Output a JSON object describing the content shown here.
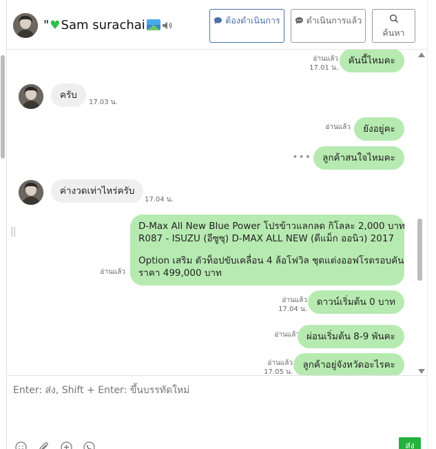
{
  "header": {
    "contact_prefix": "\"",
    "contact_name": "Sam surachai",
    "buttons": {
      "to_do": "ต้องดำเนินการ",
      "done": "ดำเนินการแล้ว",
      "search": "ค้นหา"
    }
  },
  "messages": [
    {
      "dir": "out",
      "text": "คันนี้ไหมคะ",
      "read": "อ่านแล้ว",
      "time": "17.01 น."
    },
    {
      "dir": "in",
      "text": "ครับ",
      "time": "17.03 น."
    },
    {
      "dir": "out",
      "text": "ยังอยู่คะ",
      "read": "อ่านแล้ว",
      "time": ""
    },
    {
      "dir": "out",
      "text": "ลูกค้าสนใจไหมคะ",
      "read": "",
      "time": ""
    },
    {
      "dir": "in",
      "text": "ค่างวดเท่าไหร่ครับ",
      "time": "17.04 น."
    },
    {
      "dir": "out",
      "line1": "D-Max All New Blue Power โปรข้าวแลกลด กิโลละ 2,000 บาท",
      "line2": "R087 - ISUZU (อีซูซุ) D-MAX ALL NEW (ดีแม็ก ออนิว) 2017",
      "line3": " Option เสริม ตัวท็อปขับเคลื่อน 4 ล้อโฟวิล ชุดแต่งออฟโรดรอบคัน",
      "line4": "ราคา 499,000 บาท",
      "read": "อ่านแล้ว"
    },
    {
      "dir": "out",
      "text": "ดาวน์เริ่มต้น 0 บาท",
      "read": "อ่านแล้ว",
      "time": "17.04 น."
    },
    {
      "dir": "out",
      "text": "ผ่อนเริ่มต้น 8-9 พันคะ",
      "read": "อ่านแล้ว",
      "time": ""
    },
    {
      "dir": "out",
      "text": "ลูกค้าอยู่จังหวัดอะไรคะ",
      "read": "อ่านแล้ว",
      "time": "17.05 น."
    }
  ],
  "composer": {
    "placeholder": "Enter: ส่ง, Shift + Enter: ขึ้นบรรทัดใหม่",
    "send_label": "ส่ง"
  },
  "colors": {
    "outgoing_bubble": "#b7eab1",
    "incoming_bubble": "#efefef",
    "send_button": "#23b23e",
    "primary_button_border": "#4a6fa8"
  },
  "icons": [
    "speaker-icon",
    "chat-bubble-icon",
    "search-icon",
    "emoji-icon",
    "attachment-icon",
    "add-icon",
    "phone-icon",
    "typing-dots-icon"
  ]
}
